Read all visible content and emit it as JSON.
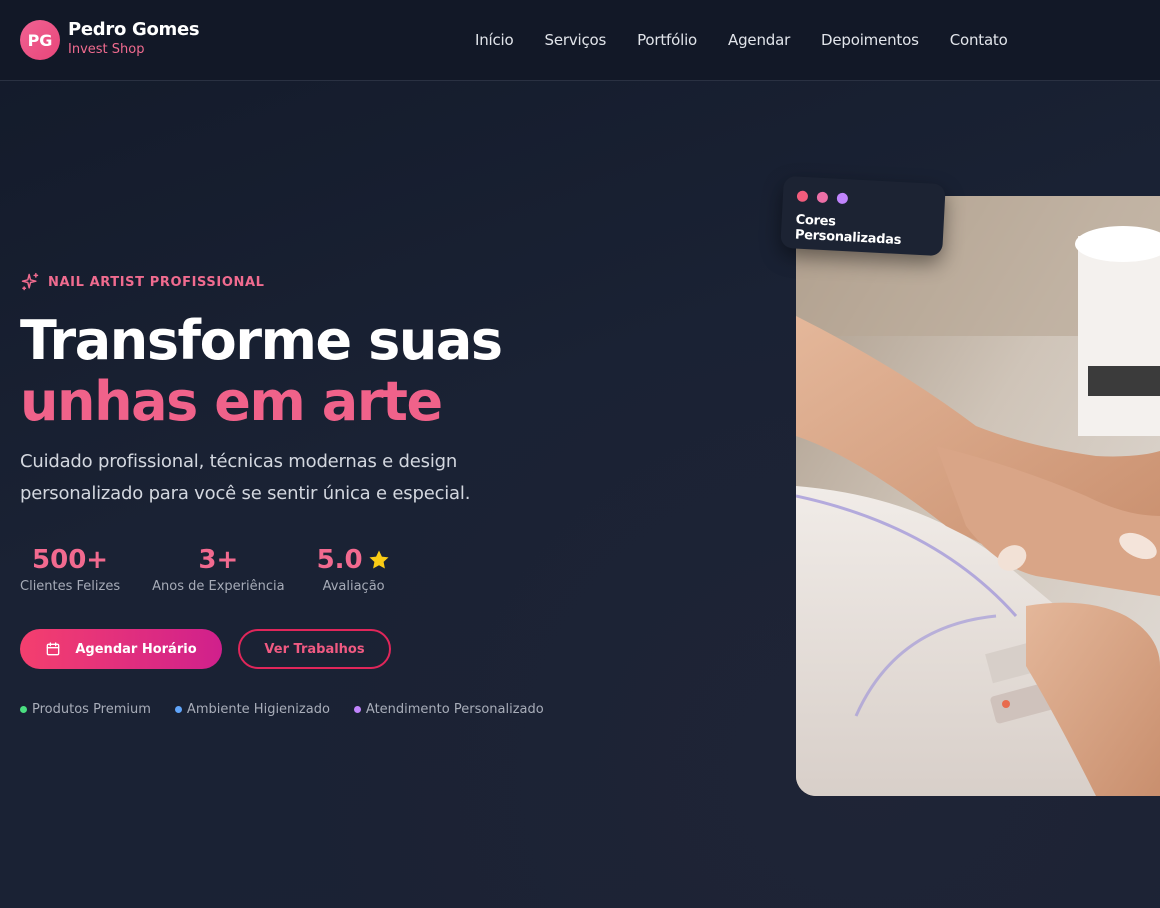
{
  "brand": {
    "initials": "PG",
    "name": "Pedro Gomes",
    "subtitle": "Invest Shop"
  },
  "nav": {
    "items": [
      {
        "label": "Início"
      },
      {
        "label": "Serviços"
      },
      {
        "label": "Portfólio"
      },
      {
        "label": "Agendar"
      },
      {
        "label": "Depoimentos"
      },
      {
        "label": "Contato"
      }
    ]
  },
  "hero": {
    "eyebrow": "NAIL ARTIST PROFISSIONAL",
    "eyebrow_icon": "sparkles-icon",
    "title_line1": "Transforme suas",
    "title_line2": "unhas em arte",
    "subtitle": "Cuidado profissional, técnicas modernas e design personalizado para você se sentir única e especial.",
    "stats": [
      {
        "value": "500+",
        "label": "Clientes Felizes"
      },
      {
        "value": "3+",
        "label": "Anos de Experiência"
      },
      {
        "value": "5.0",
        "label": "Avaliação",
        "icon": "star-icon"
      }
    ],
    "primary_button": {
      "label": "Agendar Horário",
      "icon": "calendar-icon"
    },
    "secondary_button": {
      "label": "Ver Trabalhos"
    },
    "features": [
      {
        "label": "Produtos Premium",
        "color": "#4ade80"
      },
      {
        "label": "Ambiente Higienizado",
        "color": "#60a5fa"
      },
      {
        "label": "Atendimento Personalizado",
        "color": "#c084fc"
      }
    ],
    "floating_card": {
      "label": "Cores Personalizadas",
      "dot_colors": [
        "#f25c7c",
        "#ec6fa6",
        "#c084fc"
      ]
    }
  },
  "colors": {
    "accent": "#f0628a",
    "background": "#1a2234",
    "navbar": "#121827"
  }
}
